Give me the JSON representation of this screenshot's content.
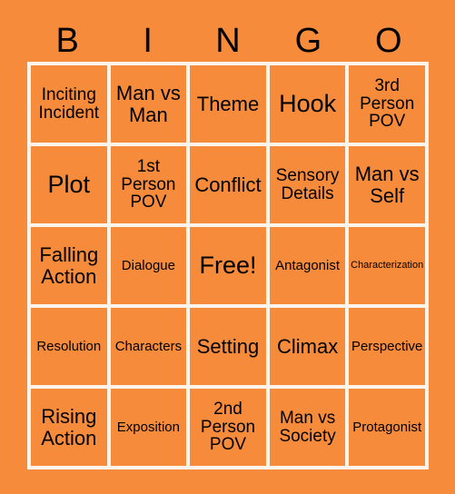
{
  "header": {
    "letters": [
      "B",
      "I",
      "N",
      "G",
      "O"
    ]
  },
  "grid": {
    "rows": [
      [
        {
          "text": "Inciting Incident",
          "size": "fs-m"
        },
        {
          "text": "Man vs Man",
          "size": "fs-l"
        },
        {
          "text": "Theme",
          "size": "fs-l"
        },
        {
          "text": "Hook",
          "size": "fs-xl"
        },
        {
          "text": "3rd Person POV",
          "size": "fs-m"
        }
      ],
      [
        {
          "text": "Plot",
          "size": "fs-xl"
        },
        {
          "text": "1st Person POV",
          "size": "fs-m"
        },
        {
          "text": "Conflict",
          "size": "fs-l"
        },
        {
          "text": "Sensory Details",
          "size": "fs-m"
        },
        {
          "text": "Man vs Self",
          "size": "fs-l"
        }
      ],
      [
        {
          "text": "Falling Action",
          "size": "fs-l"
        },
        {
          "text": "Dialogue",
          "size": "fs-s"
        },
        {
          "text": "Free!",
          "size": "fs-xl"
        },
        {
          "text": "Antagonist",
          "size": "fs-s"
        },
        {
          "text": "Characterization",
          "size": "fs-xs"
        }
      ],
      [
        {
          "text": "Resolution",
          "size": "fs-s"
        },
        {
          "text": "Characters",
          "size": "fs-s"
        },
        {
          "text": "Setting",
          "size": "fs-l"
        },
        {
          "text": "Climax",
          "size": "fs-l"
        },
        {
          "text": "Perspective",
          "size": "fs-s"
        }
      ],
      [
        {
          "text": "Rising Action",
          "size": "fs-l"
        },
        {
          "text": "Exposition",
          "size": "fs-s"
        },
        {
          "text": "2nd Person POV",
          "size": "fs-m"
        },
        {
          "text": "Man vs Society",
          "size": "fs-m"
        },
        {
          "text": "Protagonist",
          "size": "fs-s"
        }
      ]
    ]
  },
  "colors": {
    "background": "#F78B3C",
    "border": "#FAF4EC",
    "text": "#000000"
  }
}
